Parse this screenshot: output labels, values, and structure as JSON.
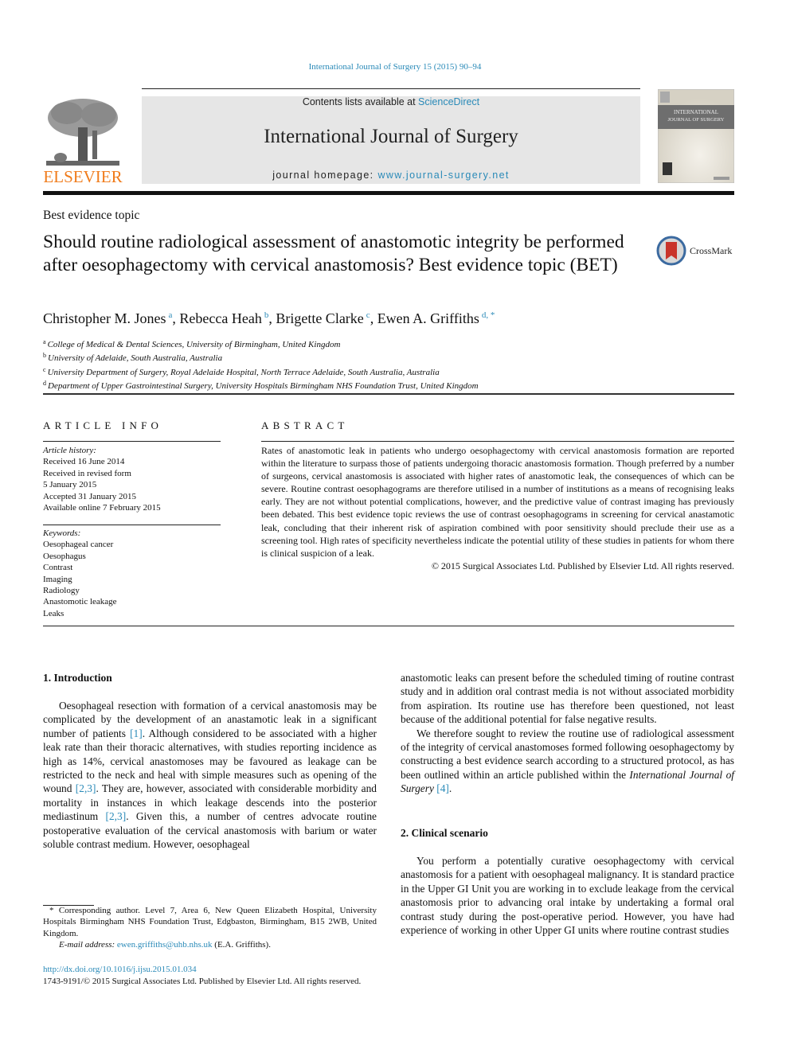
{
  "header": {
    "citation": "International Journal of Surgery 15 (2015) 90–94",
    "contents_prefix": "Contents lists available at ",
    "contents_link": "ScienceDirect",
    "journal_title": "International Journal of Surgery",
    "homepage_prefix": "journal homepage: ",
    "homepage_link": "www.journal-surgery.net",
    "publisher_logo": "ELSEVIER",
    "cover_title_line1": "INTERNATIONAL",
    "cover_title_line2": "JOURNAL OF SURGERY",
    "crossmark_label": "CrossMark"
  },
  "article": {
    "section_label": "Best evidence topic",
    "title": "Should routine radiological assessment of anastomotic integrity be performed after oesophagectomy with cervical anastomosis? Best evidence topic (BET)",
    "authors": [
      {
        "name": "Christopher M. Jones",
        "sup": "a",
        "sep": ", "
      },
      {
        "name": "Rebecca Heah",
        "sup": "b",
        "sep": ", "
      },
      {
        "name": "Brigette Clarke",
        "sup": "c",
        "sep": ", "
      },
      {
        "name": "Ewen A. Griffiths",
        "sup": "d, *",
        "sep": ""
      }
    ],
    "affiliations": [
      {
        "key": "a",
        "text": "College of Medical & Dental Sciences, University of Birmingham, United Kingdom"
      },
      {
        "key": "b",
        "text": "University of Adelaide, South Australia, Australia"
      },
      {
        "key": "c",
        "text": "University Department of Surgery, Royal Adelaide Hospital, North Terrace Adelaide, South Australia, Australia"
      },
      {
        "key": "d",
        "text": "Department of Upper Gastrointestinal Surgery, University Hospitals Birmingham NHS Foundation Trust, United Kingdom"
      }
    ]
  },
  "article_info": {
    "heading": "ARTICLE INFO",
    "history_label": "Article history:",
    "history": [
      "Received 16 June 2014",
      "Received in revised form",
      "5 January 2015",
      "Accepted 31 January 2015",
      "Available online 7 February 2015"
    ],
    "keywords_label": "Keywords:",
    "keywords": [
      "Oesophageal cancer",
      "Oesophagus",
      "Contrast",
      "Imaging",
      "Radiology",
      "Anastomotic leakage",
      "Leaks"
    ]
  },
  "abstract": {
    "heading": "ABSTRACT",
    "text": "Rates of anastomotic leak in patients who undergo oesophagectomy with cervical anastomosis formation are reported within the literature to surpass those of patients undergoing thoracic anastomosis formation. Though preferred by a number of surgeons, cervical anastomosis is associated with higher rates of anastomotic leak, the consequences of which can be severe. Routine contrast oesophagograms are therefore utilised in a number of institutions as a means of recognising leaks early. They are not without potential complications, however, and the predictive value of contrast imaging has previously been debated. This best evidence topic reviews the use of contrast oesophagograms in screening for cervical anastamotic leak, concluding that their inherent risk of aspiration combined with poor sensitivity should preclude their use as a screening tool. High rates of specificity nevertheless indicate the potential utility of these studies in patients for whom there is clinical suspicion of a leak.",
    "copyright": "© 2015 Surgical Associates Ltd. Published by Elsevier Ltd. All rights reserved."
  },
  "body": {
    "intro_heading": "1.  Introduction",
    "intro_p1_a": "Oesophageal resection with formation of a cervical anastomosis may be complicated by the development of an anastamotic leak in a significant number of patients ",
    "intro_ref1": "[1]",
    "intro_p1_b": ". Although considered to be associated with a higher leak rate than their thoracic alternatives, with studies reporting incidence as high as 14%, cervical anastomoses may be favoured as leakage can be restricted to the neck and heal with simple measures such as opening of the wound ",
    "intro_ref2": "[2,3]",
    "intro_p1_c": ". They are, however, associated with considerable morbidity and mortality in instances in which leakage descends into the posterior mediastinum ",
    "intro_ref3": "[2,3]",
    "intro_p1_d": ". Given this, a number of centres advocate routine postoperative evaluation of the cervical anastomosis with barium or water soluble contrast medium. However, oesophageal",
    "right_p1": "anastomotic leaks can present before the scheduled timing of routine contrast study and in addition oral contrast media is not without associated morbidity from aspiration. Its routine use has therefore been questioned, not least because of the additional potential for false negative results.",
    "right_p2_a": "We therefore sought to review the routine use of radiological assessment of the integrity of cervical anastomoses formed following oesophagectomy by constructing a best evidence search according to a structured protocol, as has been outlined within an article published within the ",
    "right_p2_journal": "International Journal of Surgery",
    "right_p2_ref": "[4]",
    "right_p2_end": ".",
    "clinical_heading": "2.  Clinical scenario",
    "clinical_p1": "You perform a potentially curative oesophagectomy with cervical anastomosis for a patient with oesophageal malignancy. It is standard practice in the Upper GI Unit you are working in to exclude leakage from the cervical anastomosis prior to advancing oral intake by undertaking a formal oral contrast study during the post-operative period. However, you have had experience of working in other Upper GI units where routine contrast studies"
  },
  "footnote": {
    "corresponding": "* Corresponding author. Level 7, Area 6, New Queen Elizabeth Hospital, University Hospitals Birmingham NHS Foundation Trust, Edgbaston, Birmingham, B15 2WB, United Kingdom.",
    "email_label": "E-mail address: ",
    "email": "ewen.griffiths@uhb.nhs.uk",
    "email_suffix": " (E.A. Griffiths).",
    "doi": "http://dx.doi.org/10.1016/j.ijsu.2015.01.034",
    "issn_line": "1743-9191/© 2015 Surgical Associates Ltd. Published by Elsevier Ltd. All rights reserved."
  },
  "colors": {
    "link": "#2a8ab8",
    "elsevier_orange": "#f07c1c",
    "masthead_bg": "#e6e6e6"
  }
}
